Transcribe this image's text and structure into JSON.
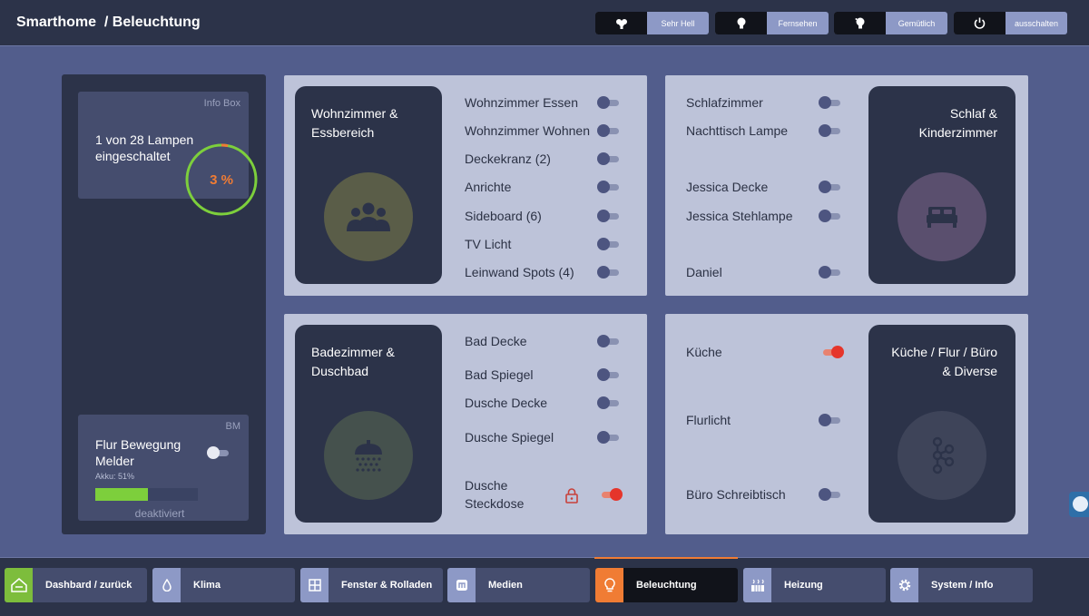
{
  "header": {
    "title": "Smarthome  / Beleuchtung",
    "scenes": [
      {
        "label": "Sehr Hell",
        "icon": "bulbs-icon"
      },
      {
        "label": "Fernsehen",
        "icon": "bulb-icon"
      },
      {
        "label": "Gemütlich",
        "icon": "dim-bulb-icon"
      },
      {
        "label": "ausschalten",
        "icon": "power-icon"
      }
    ]
  },
  "info_box": {
    "corner_label": "Info Box",
    "text": "1 von 28 Lampen eingeschaltet",
    "gauge_value": "3 %",
    "gauge_fraction": 0.03,
    "gauge_color": "#7dcf3c",
    "gauge_accent": "#f07c34"
  },
  "motion_box": {
    "corner_label": "BM",
    "title": "Flur Bewegung Melder",
    "akku": "Akku: 51%",
    "battery_fraction": 0.51,
    "status": "deaktiviert",
    "toggle_on": false
  },
  "rooms": {
    "wohnzimmer": {
      "name_line1": "Wohnzimmer &",
      "name_line2": "Essbereich",
      "icon": "group-icon",
      "icon_color": "#5a5d48",
      "lamps": [
        {
          "label": "Wohnzimmer Essen",
          "on": false
        },
        {
          "label": "Wohnzimmer Wohnen",
          "on": false
        },
        {
          "label": "Deckekranz (2)",
          "on": false
        },
        {
          "label": "Anrichte",
          "on": false
        },
        {
          "label": "Sideboard (6)",
          "on": false
        },
        {
          "label": "TV Licht",
          "on": false
        },
        {
          "label": "Leinwand Spots (4)",
          "on": false
        }
      ]
    },
    "schlafzimmer": {
      "name_line1": "Schlaf &",
      "name_line2": "Kinderzimmer",
      "icon": "bed-icon",
      "icon_color": "#5a4f6e",
      "lamps": [
        {
          "label": "Schlafzimmer",
          "on": false
        },
        {
          "label": "Nachttisch Lampe",
          "on": false
        },
        {
          "label": "Jessica Decke",
          "on": false
        },
        {
          "label": "Jessica Stehlampe",
          "on": false
        },
        {
          "label": "Daniel",
          "on": false
        }
      ]
    },
    "badezimmer": {
      "name_line1": "Badezimmer &",
      "name_line2": "Duschbad",
      "icon": "shower-icon",
      "icon_color": "#45514d",
      "lamps": [
        {
          "label": "Bad Decke",
          "on": false
        },
        {
          "label": "Bad Spiegel",
          "on": false
        },
        {
          "label": "Dusche Decke",
          "on": false
        },
        {
          "label": "Dusche Spiegel",
          "on": false
        },
        {
          "label": "Dusche Steckdose",
          "on": true,
          "locked": true
        }
      ]
    },
    "kueche": {
      "name_line1": "Küche / Flur / Büro",
      "name_line2": "& Diverse",
      "icon": "hub-icon",
      "icon_color": "#3e4459",
      "lamps": [
        {
          "label": "Küche",
          "on": true
        },
        {
          "label": "Flurlicht",
          "on": false
        },
        {
          "label": "Büro Schreibtisch",
          "on": false
        }
      ]
    }
  },
  "nav": [
    {
      "label": "Dashbard / zurück",
      "icon": "home-icon",
      "active": false
    },
    {
      "label": "Klima",
      "icon": "drop-icon",
      "active": false
    },
    {
      "label": "Fenster & Rolladen",
      "icon": "window-icon",
      "active": false
    },
    {
      "label": "Medien",
      "icon": "media-icon",
      "active": false
    },
    {
      "label": "Beleuchtung",
      "icon": "lightbulb-icon",
      "active": true
    },
    {
      "label": "Heizung",
      "icon": "heating-icon",
      "active": false
    },
    {
      "label": "System / Info",
      "icon": "gear-icon",
      "active": false
    }
  ],
  "colors": {
    "accent": "#f07c34",
    "background": "#525d8c",
    "panel": "#bdc3d9",
    "card": "#2c3349",
    "toggle_on": "#e5352b"
  }
}
